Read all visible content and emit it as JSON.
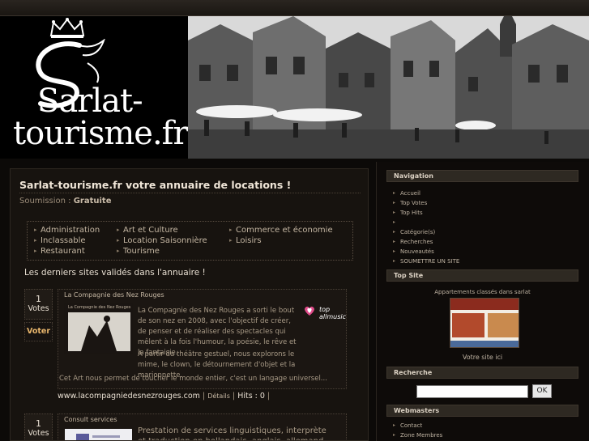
{
  "header": {
    "logo_line1": "Sarlat-",
    "logo_line2": "tourisme.fr"
  },
  "main": {
    "title": "Sarlat-tourisme.fr votre annuaire de locations !",
    "submission_label": "Soumission :",
    "submission_value": "Gratuite",
    "categories": [
      "Administration",
      "Art et Culture",
      "Commerce et économie",
      "Inclassable",
      "Location Saisonnière",
      "Loisirs",
      "Restaurant",
      "Tourisme"
    ],
    "latest_heading": "Les derniers sites validés dans l'annuaire !",
    "listings": [
      {
        "votes": "1",
        "votes_label": "Votes",
        "vote_button": "Voter",
        "title": "La Compagnie des Nez Rouges",
        "thumb_caption": "La Compagnie des Nez Rouges",
        "desc1": "La Compagnie des Nez Rouges a sorti le bout de son nez en 2008, avec l'objectif de créer, de penser et de réaliser des spectacles qui mêlent à la fois l'humour, la poésie, le rêve et la fantaisie.",
        "desc2": "A partir du théâtre gestuel, nous explorons le mime, le clown,  le détournement d'objet et la marionnette.",
        "desc3": "Cet Art nous permet de toucher le monde entier, c'est un langage universel...",
        "badge": "top allmusic",
        "url": "www.lacompagniedesnezrouges.com",
        "detail": "Détails",
        "hits": "Hits : 0"
      },
      {
        "votes": "1",
        "votes_label": "Votes",
        "title": "Consult services",
        "desc1": "Prestation de services linguistiques, interprète et traduction en hollandais, anglais, allemand, français"
      }
    ]
  },
  "sidebar": {
    "navigation_title": "Navigation",
    "nav_items": [
      "Accueil",
      "Top Votes",
      "Top Hits",
      "",
      "Catégorie(s)",
      "Recherches",
      "Nouveautés",
      "SOUMETTRE UN SITE"
    ],
    "topsite_title": "Top Site",
    "topsite_caption": "Appartements classés dans sarlat",
    "topsite_cta": "Votre site ici",
    "search_title": "Recherche",
    "search_button": "OK",
    "webmasters_title": "Webmasters",
    "webmaster_items": [
      "Contact",
      "Zone Membres"
    ]
  }
}
